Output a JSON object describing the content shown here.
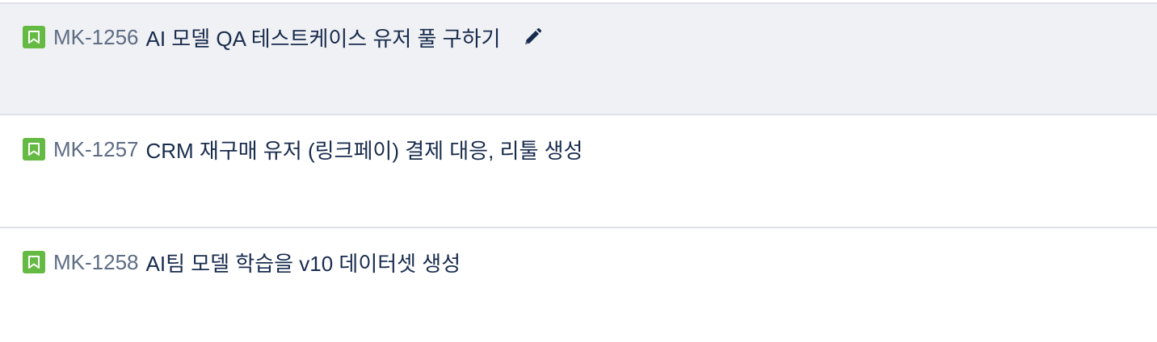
{
  "issues": [
    {
      "key": "MK-1256",
      "summary": "AI 모델 QA 테스트케이스 유저 풀 구하기",
      "type_icon": "story-bookmark-icon",
      "hovered": true
    },
    {
      "key": "MK-1257",
      "summary": "CRM 재구매 유저 (링크페이) 결제 대응, 리툴 생성",
      "type_icon": "story-bookmark-icon",
      "hovered": false
    },
    {
      "key": "MK-1258",
      "summary": "AI팀 모델 학습을 v10 데이터셋 생성",
      "type_icon": "story-bookmark-icon",
      "hovered": false
    }
  ],
  "colors": {
    "story_icon": "#65ba43",
    "key_text": "#5e6c84",
    "summary_text": "#172b4d",
    "hover_bg": "#f0f1f4",
    "divider": "#dfe1e6"
  },
  "edit_icon": "pencil-icon"
}
